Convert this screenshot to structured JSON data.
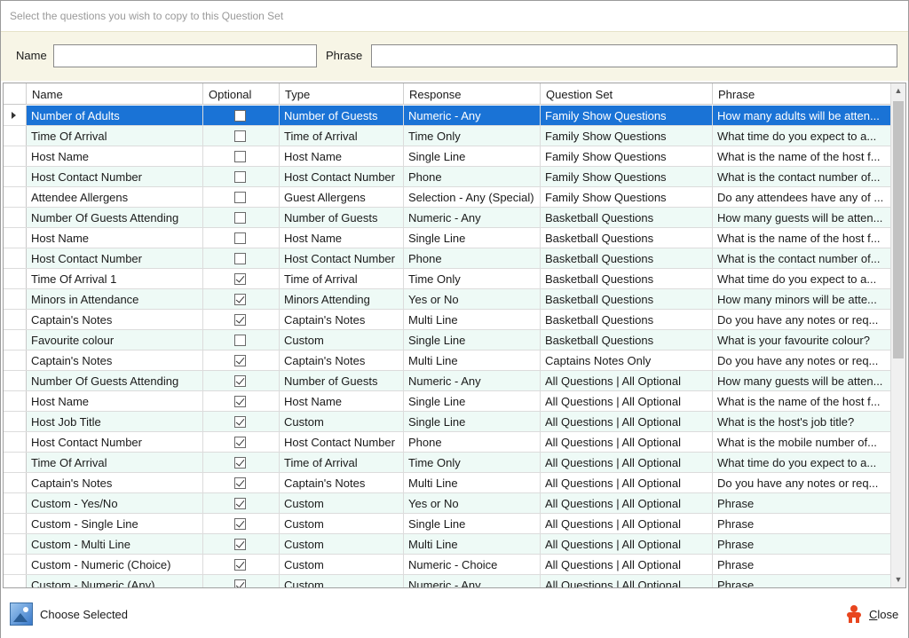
{
  "window": {
    "title": "Select the questions you wish to copy to this Question Set"
  },
  "filters": {
    "name_label": "Name",
    "name_value": "",
    "phrase_label": "Phrase",
    "phrase_value": ""
  },
  "grid": {
    "columns": {
      "name": "Name",
      "optional": "Optional",
      "type": "Type",
      "response": "Response",
      "question_set": "Question Set",
      "phrase": "Phrase"
    },
    "selected_index": 0,
    "rows": [
      {
        "name": "Number of Adults",
        "optional": false,
        "type": "Number of Guests",
        "response": "Numeric - Any",
        "question_set": "Family Show Questions",
        "phrase": "How many adults will be atten..."
      },
      {
        "name": "Time Of Arrival",
        "optional": false,
        "type": "Time of Arrival",
        "response": "Time Only",
        "question_set": "Family Show Questions",
        "phrase": "What time do you expect to a..."
      },
      {
        "name": "Host Name",
        "optional": false,
        "type": "Host Name",
        "response": "Single Line",
        "question_set": "Family Show Questions",
        "phrase": "What is the name of the host f..."
      },
      {
        "name": "Host Contact Number",
        "optional": false,
        "type": "Host Contact Number",
        "response": "Phone",
        "question_set": "Family Show Questions",
        "phrase": "What is the contact number of..."
      },
      {
        "name": "Attendee Allergens",
        "optional": false,
        "type": "Guest Allergens",
        "response": "Selection - Any (Special)",
        "question_set": "Family Show Questions",
        "phrase": "Do any attendees have any of ..."
      },
      {
        "name": "Number Of Guests Attending",
        "optional": false,
        "type": "Number of Guests",
        "response": "Numeric - Any",
        "question_set": "Basketball Questions",
        "phrase": "How many guests will be atten..."
      },
      {
        "name": "Host Name",
        "optional": false,
        "type": "Host Name",
        "response": "Single Line",
        "question_set": "Basketball Questions",
        "phrase": "What is the name of the host f..."
      },
      {
        "name": "Host Contact Number",
        "optional": false,
        "type": "Host Contact Number",
        "response": "Phone",
        "question_set": "Basketball Questions",
        "phrase": "What is the contact number of..."
      },
      {
        "name": "Time Of Arrival 1",
        "optional": true,
        "type": "Time of Arrival",
        "response": "Time Only",
        "question_set": "Basketball Questions",
        "phrase": "What time do you expect to a..."
      },
      {
        "name": "Minors in Attendance",
        "optional": true,
        "type": "Minors Attending",
        "response": "Yes or No",
        "question_set": "Basketball Questions",
        "phrase": "How many minors will be atte..."
      },
      {
        "name": "Captain's Notes",
        "optional": true,
        "type": "Captain's Notes",
        "response": "Multi Line",
        "question_set": "Basketball Questions",
        "phrase": "Do you have any notes or req..."
      },
      {
        "name": "Favourite colour",
        "optional": false,
        "type": "Custom",
        "response": "Single Line",
        "question_set": "Basketball Questions",
        "phrase": "What is your favourite colour?"
      },
      {
        "name": "Captain's Notes",
        "optional": true,
        "type": "Captain's Notes",
        "response": "Multi Line",
        "question_set": "Captains Notes Only",
        "phrase": "Do you have any notes or req..."
      },
      {
        "name": "Number Of Guests Attending",
        "optional": true,
        "type": "Number of Guests",
        "response": "Numeric - Any",
        "question_set": "All Questions | All Optional",
        "phrase": "How many guests will be atten..."
      },
      {
        "name": "Host Name",
        "optional": true,
        "type": "Host Name",
        "response": "Single Line",
        "question_set": "All Questions | All Optional",
        "phrase": "What is the name of the host f..."
      },
      {
        "name": "Host Job Title",
        "optional": true,
        "type": "Custom",
        "response": "Single Line",
        "question_set": "All Questions | All Optional",
        "phrase": "What is the host's job title?"
      },
      {
        "name": "Host Contact Number",
        "optional": true,
        "type": "Host Contact Number",
        "response": "Phone",
        "question_set": "All Questions | All Optional",
        "phrase": "What is the mobile number of..."
      },
      {
        "name": "Time Of Arrival",
        "optional": true,
        "type": "Time of Arrival",
        "response": "Time Only",
        "question_set": "All Questions | All Optional",
        "phrase": "What time do you expect to a..."
      },
      {
        "name": "Captain's Notes",
        "optional": true,
        "type": "Captain's Notes",
        "response": "Multi Line",
        "question_set": "All Questions | All Optional",
        "phrase": "Do you have any notes or req..."
      },
      {
        "name": "Custom - Yes/No",
        "optional": true,
        "type": "Custom",
        "response": "Yes or No",
        "question_set": "All Questions | All Optional",
        "phrase": "Phrase"
      },
      {
        "name": "Custom - Single Line",
        "optional": true,
        "type": "Custom",
        "response": "Single Line",
        "question_set": "All Questions | All Optional",
        "phrase": "Phrase"
      },
      {
        "name": "Custom - Multi Line",
        "optional": true,
        "type": "Custom",
        "response": "Multi Line",
        "question_set": "All Questions | All Optional",
        "phrase": "Phrase"
      },
      {
        "name": "Custom - Numeric (Choice)",
        "optional": true,
        "type": "Custom",
        "response": "Numeric - Choice",
        "question_set": "All Questions | All Optional",
        "phrase": "Phrase"
      },
      {
        "name": "Custom - Numeric (Any)",
        "optional": true,
        "type": "Custom",
        "response": "Numeric - Any",
        "question_set": "All Questions | All Optional",
        "phrase": "Phrase"
      }
    ]
  },
  "footer": {
    "choose_label": "Choose Selected",
    "choose_icon": "image-select-icon",
    "close_label": "Close",
    "close_icon": "person-exit-icon"
  }
}
